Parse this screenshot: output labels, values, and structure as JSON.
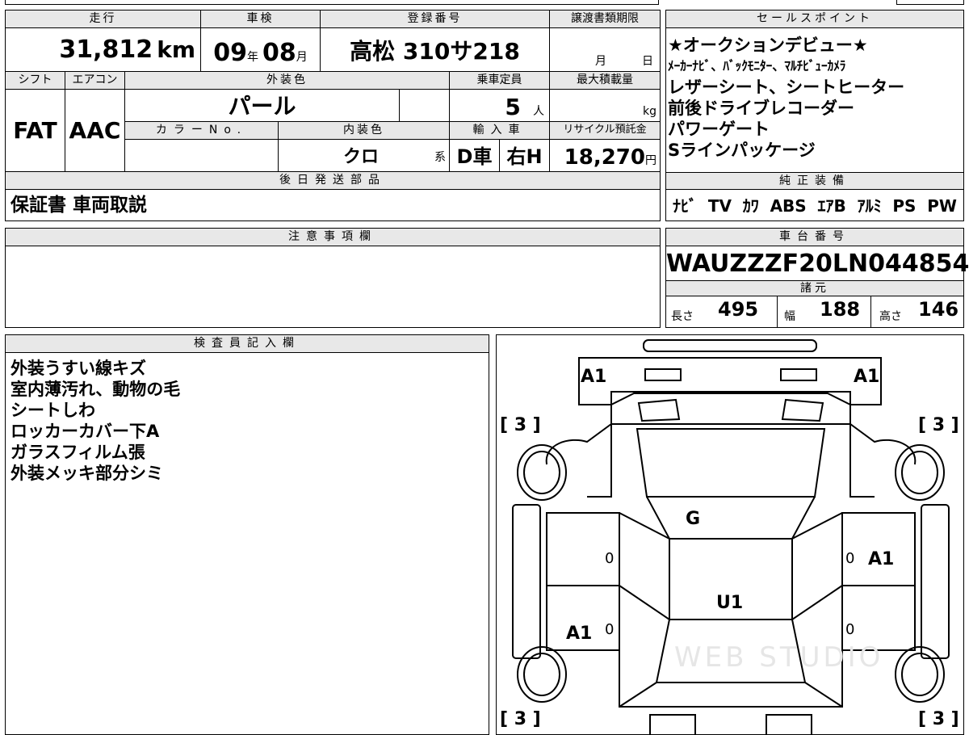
{
  "top": {
    "mileage_label": "走行",
    "mileage_value": "31,812",
    "mileage_unit": "km",
    "shaken_label": "車検",
    "shaken_year": "09",
    "shaken_year_unit": "年",
    "shaken_month": "08",
    "shaken_month_unit": "月",
    "reg_label": "登録番号",
    "reg_value": "高松 310サ218",
    "transfer_label": "譲渡書類期限",
    "transfer_month": "月",
    "transfer_day": "日"
  },
  "mid": {
    "shift_label": "シフト",
    "shift_value": "FAT",
    "ac_label": "エアコン",
    "ac_value": "AAC",
    "ext_color_label": "外装色",
    "ext_color_value": "パール",
    "color_no_label": "カラーNo.",
    "int_color_label": "内装色",
    "int_color_value": "クロ",
    "int_color_suffix": "系",
    "capacity_label": "乗車定員",
    "capacity_value": "5",
    "capacity_unit": "人",
    "import_label": "輸入車",
    "import_value": "D車",
    "steering_value": "右H",
    "max_load_label": "最大積載量",
    "max_load_unit": "kg",
    "recycle_label": "リサイクル預託金",
    "recycle_value": "18,270",
    "recycle_unit": "円"
  },
  "later": {
    "label": "後日発送部品",
    "value": "保証書 車両取説"
  },
  "sales": {
    "label": "セールスポイント",
    "lines": [
      "★オークションデビュー★",
      "ﾒｰｶｰﾅﾋﾞ、ﾊﾞｯｸﾓﾆﾀｰ、ﾏﾙﾁﾋﾞｭｰｶﾒﾗ",
      "レザーシート、シートヒーター",
      "前後ドライブレコーダー",
      "パワーゲート",
      "Sラインパッケージ"
    ]
  },
  "equipment": {
    "label": "純正装備",
    "items": [
      "ﾅﾋﾞ",
      "TV",
      "ｶﾜ",
      "ABS",
      "ｴｱB",
      "ｱﾙﾐ",
      "PS",
      "PW"
    ]
  },
  "notes": {
    "label": "注意事項欄"
  },
  "chassis": {
    "label": "車台番号",
    "value": "WAUZZZF20LN044854",
    "spec_label": "諸元",
    "length_label": "長さ",
    "length_value": "495",
    "width_label": "幅",
    "width_value": "188",
    "height_label": "高さ",
    "height_value": "146"
  },
  "inspector": {
    "label": "検査員記入欄",
    "lines": [
      "外装うすい線キズ",
      "室内薄汚れ、動物の毛",
      "シートしわ",
      "ロッカーカバー下A",
      "ガラスフィルム張",
      "外装メッキ部分シミ"
    ]
  },
  "diagram": {
    "marks": {
      "front_left": "A1",
      "front_right": "A1",
      "windshield": "G",
      "roof": "U1",
      "right_front_door": "A1",
      "left_rear_door": "A1",
      "tyre_fl": "[ 3 ]",
      "tyre_fr": "[ 3 ]",
      "tyre_rl": "[ 3 ]",
      "tyre_rr": "[ 3 ]",
      "zero_a": "0",
      "zero_b": "0",
      "zero_c": "0",
      "zero_d": "0"
    },
    "watermark": "WEB STUDIO"
  }
}
